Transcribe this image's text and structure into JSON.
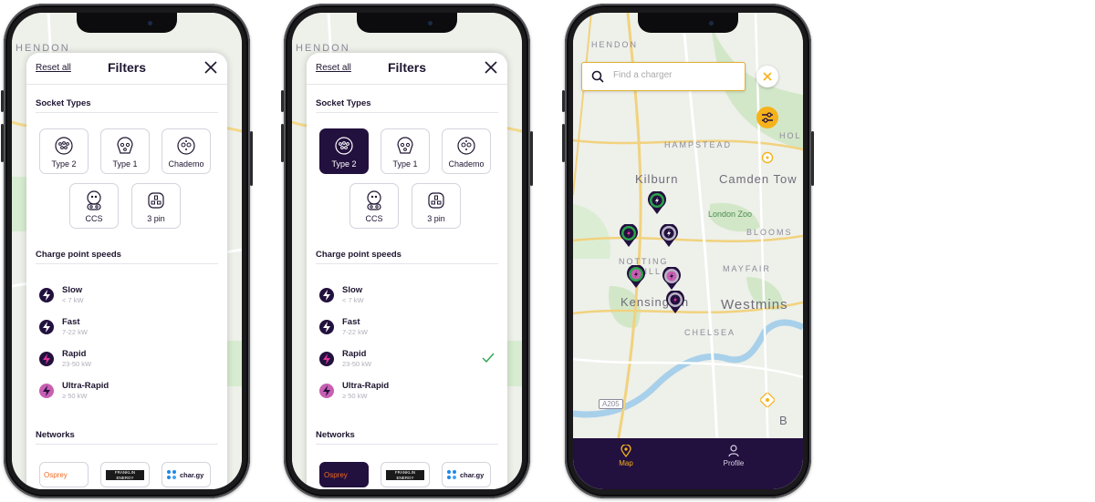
{
  "filters": {
    "reset_label": "Reset all",
    "title": "Filters",
    "socket_types_heading": "Socket Types",
    "sockets": [
      "Type 2",
      "Type 1",
      "Chademo",
      "CCS",
      "3 pin"
    ],
    "speeds_heading": "Charge point speeds",
    "speeds": [
      {
        "name": "Slow",
        "kw": "< 7 kW"
      },
      {
        "name": "Fast",
        "kw": "7-22 kW"
      },
      {
        "name": "Rapid",
        "kw": "23-50 kW"
      },
      {
        "name": "Ultra-Rapid",
        "kw": "≥ 50 kW"
      }
    ],
    "networks_heading": "Networks",
    "networks": [
      "Osprey",
      "FRANKLIN ENERGY",
      "char.gy"
    ]
  },
  "screen2_selected": {
    "socket": "Type 2",
    "speed": "Rapid",
    "network": "Osprey"
  },
  "map": {
    "search_placeholder": "Find a charger",
    "places": {
      "hendon": "HENDON",
      "hampstead": "HAMPSTEAD",
      "kilburn": "Kilburn",
      "camden": "Camden Tow",
      "london_zoo": "London Zoo",
      "blooms": "BLOOMS",
      "notting": "NOTTING",
      "hill": "HILL",
      "mayfair": "MAYFAIR",
      "kensington": "Kensington",
      "westminster": "Westmins",
      "chelsea": "CHELSEA",
      "road_a205": "A205",
      "hol": "HOL",
      "b": "B"
    },
    "tabs": {
      "map": "Map",
      "profile": "Profile"
    }
  },
  "colors": {
    "dark_purple": "#22103e",
    "accent_yellow": "#f6b21b",
    "green": "#2aa34a",
    "pink": "#e0339a"
  }
}
